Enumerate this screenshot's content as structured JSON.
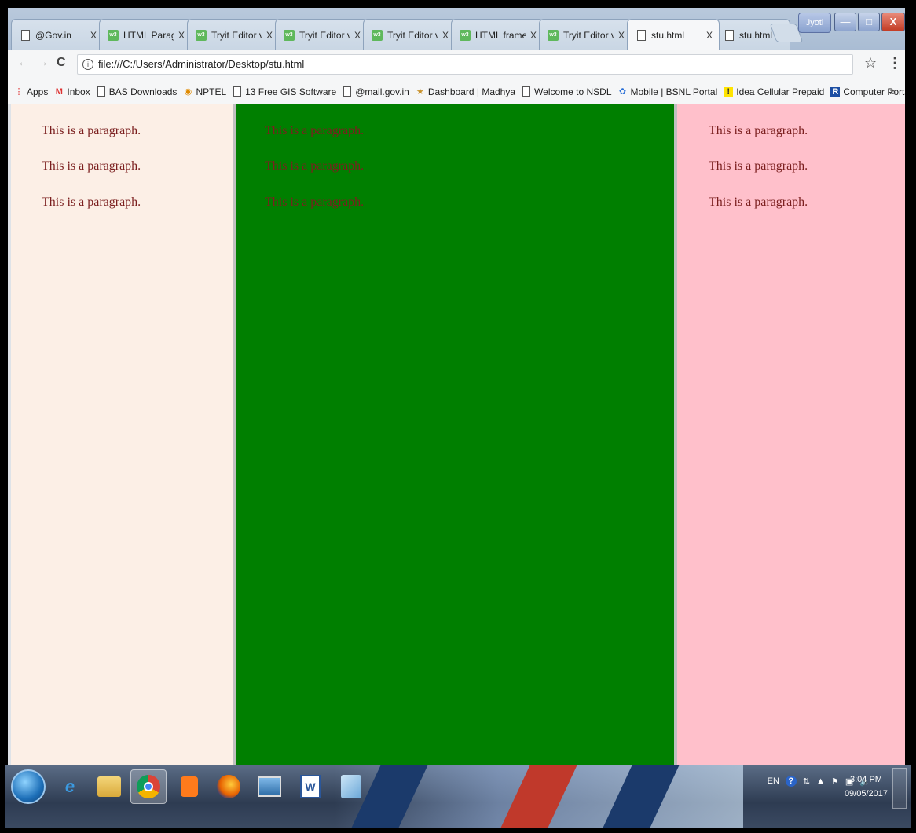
{
  "tabs": [
    {
      "title": "@Gov.in",
      "icon": "doc",
      "active": false
    },
    {
      "title": "HTML Parag",
      "icon": "w3",
      "active": false
    },
    {
      "title": "Tryit Editor v",
      "icon": "w3",
      "active": false
    },
    {
      "title": "Tryit Editor v",
      "icon": "w3",
      "active": false
    },
    {
      "title": "Tryit Editor v",
      "icon": "w3",
      "active": false
    },
    {
      "title": "HTML frame",
      "icon": "w3",
      "active": false
    },
    {
      "title": "Tryit Editor v",
      "icon": "w3",
      "active": false
    },
    {
      "title": "stu.html",
      "icon": "doc",
      "active": true
    },
    {
      "title": "stu.html",
      "icon": "doc",
      "active": false
    }
  ],
  "tab_close": "X",
  "user_badge": "Jyoti",
  "address": "file:///C:/Users/Administrator/Desktop/stu.html",
  "bookmarks": [
    {
      "label": "Apps",
      "icon": "apps-grid-icon"
    },
    {
      "label": "Inbox",
      "icon": "gmail-icon"
    },
    {
      "label": "BAS Downloads",
      "icon": "doc-icon"
    },
    {
      "label": "NPTEL",
      "icon": "nptel-icon"
    },
    {
      "label": "13 Free GIS Software",
      "icon": "doc-icon"
    },
    {
      "label": "@mail.gov.in",
      "icon": "doc-icon"
    },
    {
      "label": "Dashboard | Madhya",
      "icon": "emblem-icon"
    },
    {
      "label": "Welcome to NSDL",
      "icon": "doc-icon"
    },
    {
      "label": "Mobile | BSNL Portal",
      "icon": "bsnl-icon"
    },
    {
      "label": "Idea Cellular Prepaid",
      "icon": "idea-icon"
    },
    {
      "label": "Computer Ports - Nar",
      "icon": "r-icon"
    }
  ],
  "bookmarks_more": "»",
  "frames": [
    {
      "name": "left",
      "bg": "#fcefe6",
      "paragraphs": [
        "This is a paragraph.",
        "This is a paragraph.",
        "This is a paragraph."
      ]
    },
    {
      "name": "middle",
      "bg": "#007f00",
      "paragraphs": [
        "This is a paragraph.",
        "This is a paragraph.",
        "This is a paragraph."
      ]
    },
    {
      "name": "right",
      "bg": "#ffc0cb",
      "paragraphs": [
        "This is a paragraph.",
        "This is a paragraph.",
        "This is a paragraph."
      ]
    }
  ],
  "text_color": "#7b1f1f",
  "tray": {
    "lang": "EN"
  },
  "clock": {
    "time": "3:04 PM",
    "date": "09/05/2017"
  }
}
